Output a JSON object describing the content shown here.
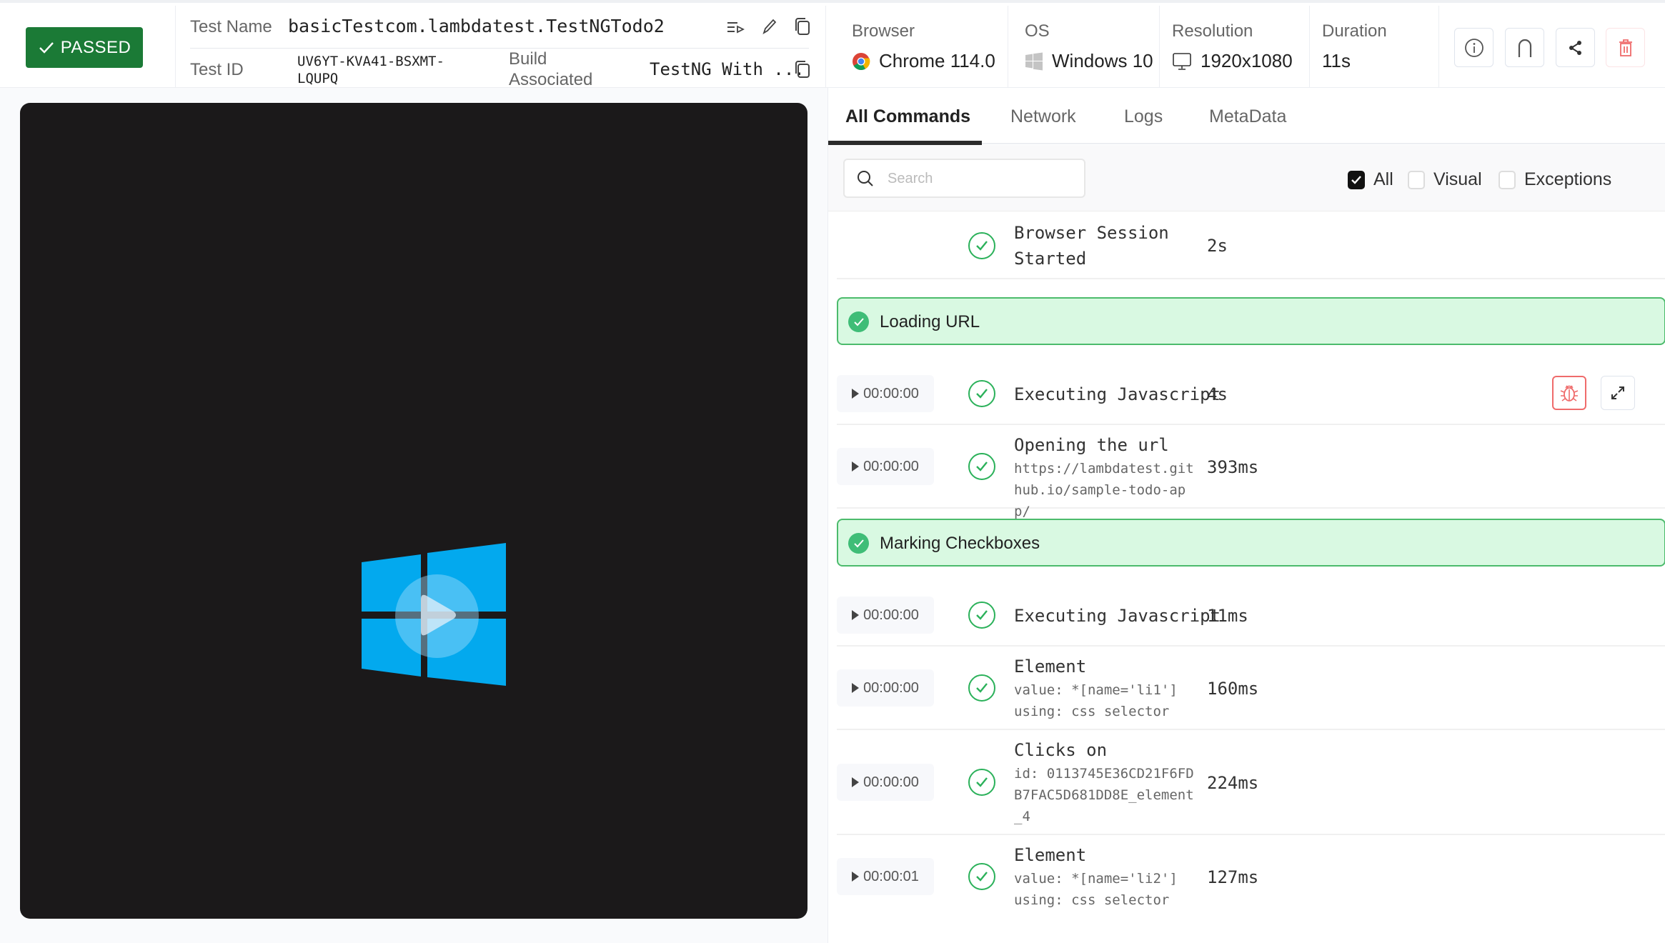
{
  "header": {
    "status_badge": "PASSED",
    "test_name_label": "Test Name",
    "test_name_value": "basicTestcom.lambdatest.TestNGTodo2",
    "test_id_label": "Test ID",
    "test_id_value": "UV6YT-KVA41-BSXMT-LQUPQ",
    "build_label": "Build Associated",
    "build_value": "TestNG With ...",
    "browser_label": "Browser",
    "browser_value": "Chrome 114.0",
    "os_label": "OS",
    "os_value": "Windows 10",
    "resolution_label": "Resolution",
    "resolution_value": "1920x1080",
    "duration_label": "Duration",
    "duration_value": "11s",
    "icons": {
      "test_name_actions": [
        "list-play-icon",
        "pencil-icon",
        "copy-icon"
      ],
      "build_actions": [
        "copy-icon"
      ],
      "right_actions": [
        "info-icon",
        "magnet-icon",
        "share-icon",
        "trash-icon"
      ]
    },
    "colors": {
      "passed": "#1b7a36",
      "delete": "#ef6b6b"
    }
  },
  "video": {
    "os_logo": "windows-logo",
    "play_icon": "play-icon",
    "colors": {
      "background": "#1b191a",
      "logo": "#03a9ee"
    }
  },
  "tabs": [
    {
      "label": "All Commands",
      "active": true
    },
    {
      "label": "Network",
      "active": false
    },
    {
      "label": "Logs",
      "active": false
    },
    {
      "label": "MetaData",
      "active": false
    }
  ],
  "filters": {
    "search_placeholder": "Search",
    "search_value": "",
    "checkboxes": [
      {
        "label": "All",
        "checked": true
      },
      {
        "label": "Visual",
        "checked": false
      },
      {
        "label": "Exceptions",
        "checked": false
      }
    ]
  },
  "commands": {
    "session": {
      "title": "Browser Session Started",
      "duration": "2s"
    },
    "groups": [
      {
        "label": "Loading URL",
        "items": [
          {
            "time": "00:00:00",
            "title": "Executing Javascript",
            "sub": [],
            "duration": "4s",
            "actions": [
              "bug-icon",
              "expand-icon"
            ]
          },
          {
            "time": "00:00:00",
            "title": "Opening the url",
            "sub": [
              "https://lambdatest.github.io/sample-todo-app/"
            ],
            "duration": "393ms"
          }
        ]
      },
      {
        "label": "Marking Checkboxes",
        "items": [
          {
            "time": "00:00:00",
            "title": "Executing Javascript",
            "sub": [],
            "duration": "11ms"
          },
          {
            "time": "00:00:00",
            "title": "Element",
            "sub": [
              "value: *[name='li1']",
              "using: css selector"
            ],
            "duration": "160ms"
          },
          {
            "time": "00:00:00",
            "title": "Clicks on",
            "sub": [
              "id: 0113745E36CD21F6FDB7FAC5D681DD8E_element_4"
            ],
            "duration": "224ms"
          },
          {
            "time": "00:00:01",
            "title": "Element",
            "sub": [
              "value: *[name='li2']",
              "using: css selector"
            ],
            "duration": "127ms"
          }
        ]
      }
    ]
  }
}
